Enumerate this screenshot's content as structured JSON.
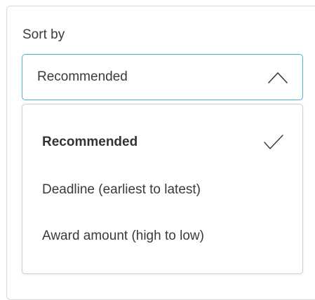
{
  "sort": {
    "label": "Sort by",
    "selected_value": "Recommended",
    "options": [
      {
        "label": "Recommended",
        "selected": true
      },
      {
        "label": "Deadline (earliest to latest)",
        "selected": false
      },
      {
        "label": "Award amount (high to low)",
        "selected": false
      }
    ]
  },
  "colors": {
    "focus_border": "#4fb3c9",
    "text": "#3a3a3a"
  },
  "icons": {
    "toggle": "chevron-up-icon",
    "selected_marker": "checkmark-icon"
  }
}
